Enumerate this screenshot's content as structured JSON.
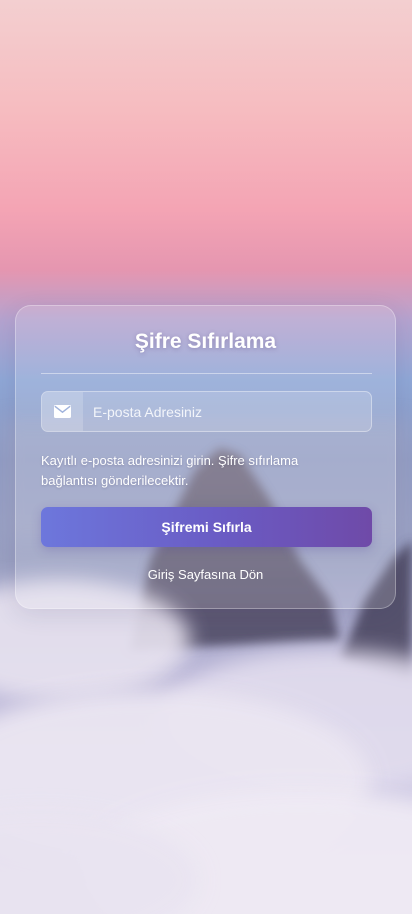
{
  "background": {
    "sky_top": "#f3cfd0",
    "sky_pink": "#f4a4b4",
    "sky_blue": "#8fa7d6",
    "cloud": "#e7e1ef"
  },
  "card": {
    "title": "Şifre Sıfırlama",
    "email_field": {
      "icon": "envelope-icon",
      "placeholder": "E-posta Adresiniz",
      "value": ""
    },
    "info_text": "Kayıtlı e-posta adresinizi girin. Şifre sıfırlama bağlantısı gönderilecektir.",
    "submit_label": "Şifremi Sıfırla",
    "back_link_label": "Giriş Sayfasına Dön"
  },
  "colors": {
    "button_gradient_start": "#6d77dc",
    "button_gradient_end": "#6f4aa8",
    "text": "#ffffff"
  }
}
